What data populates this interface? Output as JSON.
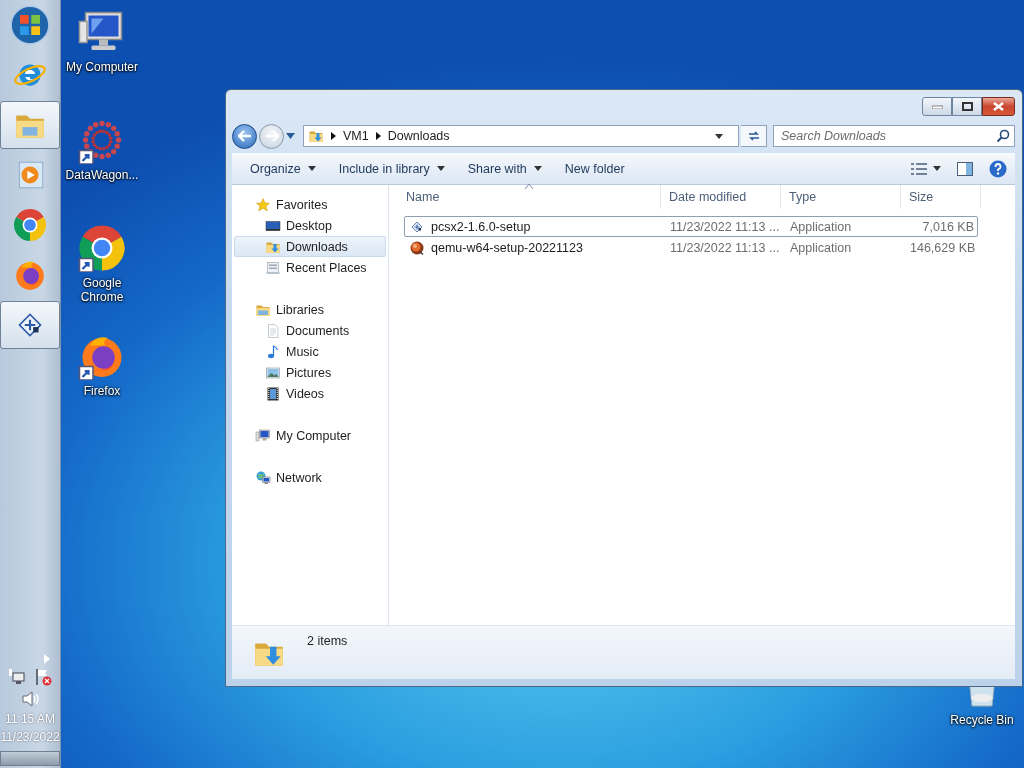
{
  "taskbar": {
    "items": [
      {
        "kind": "start",
        "active": false
      },
      {
        "kind": "ie",
        "active": false
      },
      {
        "kind": "explorer",
        "active": true
      },
      {
        "kind": "media",
        "active": false
      },
      {
        "kind": "chrome",
        "active": false
      },
      {
        "kind": "firefox",
        "active": false
      },
      {
        "kind": "app",
        "active": true
      }
    ],
    "tray": {
      "time": "11:15 AM",
      "date": "11/23/2022"
    }
  },
  "desktop_icons": [
    {
      "label": "My Computer",
      "kind": "computer",
      "shortcut": false
    },
    {
      "label": "DataWagon...",
      "kind": "datawagon",
      "shortcut": true
    },
    {
      "label": "Google Chrome",
      "kind": "chrome",
      "shortcut": true
    },
    {
      "label": "Firefox",
      "kind": "firefox",
      "shortcut": true
    }
  ],
  "recycle_bin": {
    "label": "Recycle Bin"
  },
  "window": {
    "breadcrumb": [
      "VM1",
      "Downloads"
    ],
    "search": {
      "placeholder": "Search Downloads"
    },
    "toolbar": [
      {
        "label": "Organize",
        "dropdown": true
      },
      {
        "label": "Include in library",
        "dropdown": true
      },
      {
        "label": "Share with",
        "dropdown": true
      },
      {
        "label": "New folder",
        "dropdown": false
      }
    ],
    "nav": [
      {
        "label": "Favorites",
        "kind": "star",
        "selected": false,
        "children": [
          {
            "label": "Desktop",
            "kind": "desktop",
            "selected": false
          },
          {
            "label": "Downloads",
            "kind": "downloads",
            "selected": true
          },
          {
            "label": "Recent Places",
            "kind": "recent",
            "selected": false
          }
        ]
      },
      {
        "label": "Libraries",
        "kind": "library",
        "selected": false,
        "children": [
          {
            "label": "Documents",
            "kind": "document",
            "selected": false
          },
          {
            "label": "Music",
            "kind": "music",
            "selected": false
          },
          {
            "label": "Pictures",
            "kind": "pictures",
            "selected": false
          },
          {
            "label": "Videos",
            "kind": "videos",
            "selected": false
          }
        ]
      },
      {
        "label": "My Computer",
        "kind": "mycomputer",
        "selected": false
      },
      {
        "label": "Network",
        "kind": "network",
        "selected": false
      }
    ],
    "columns": [
      {
        "label": "Name",
        "sorted": true
      },
      {
        "label": "Date modified",
        "sorted": false
      },
      {
        "label": "Type",
        "sorted": false
      },
      {
        "label": "Size",
        "sorted": false
      }
    ],
    "rows": [
      {
        "name": "pcsx2-1.6.0-setup",
        "kind": "app",
        "date": "11/23/2022 11:13 ...",
        "type": "Application",
        "size": "7,016 KB",
        "focused": true
      },
      {
        "name": "qemu-w64-setup-20221123",
        "kind": "qemu",
        "date": "11/23/2022 11:13 ...",
        "type": "Application",
        "size": "146,629 KB",
        "focused": false
      }
    ],
    "status": "2 items"
  }
}
